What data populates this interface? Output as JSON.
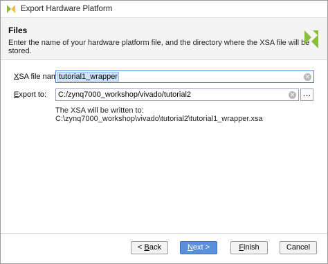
{
  "window": {
    "title": "Export Hardware Platform"
  },
  "header": {
    "title": "Files",
    "description": "Enter the name of your hardware platform file, and the directory where the XSA file will be stored."
  },
  "form": {
    "xsa_label_first": "X",
    "xsa_label_rest": "SA file name:",
    "xsa_value": "tutorial1_wrapper",
    "export_label_first": "E",
    "export_label_rest": "xport to:",
    "export_value": "C:/zynq7000_workshop/vivado/tutorial2",
    "browse_label": "…",
    "note": "The XSA will be written to: C:\\zynq7000_workshop\\vivado\\tutorial2\\tutorial1_wrapper.xsa"
  },
  "buttons": {
    "back_prefix": "< ",
    "back_key": "B",
    "back_rest": "ack",
    "next_key": "N",
    "next_rest": "ext >",
    "finish_key": "F",
    "finish_rest": "inish",
    "cancel": "Cancel"
  },
  "colors": {
    "accent": "#5a8fdc",
    "logo": "#8bbd3c"
  }
}
